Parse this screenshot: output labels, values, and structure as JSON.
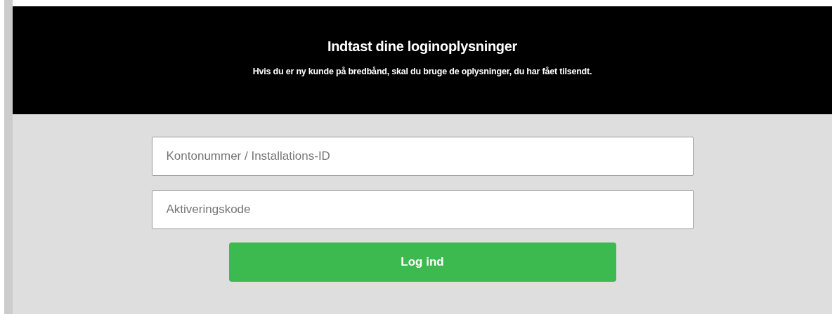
{
  "header": {
    "title": "Indtast dine loginoplysninger",
    "subtitle": "Hvis du er ny kunde på bredbånd, skal du bruge de oplysninger, du har fået tilsendt."
  },
  "fields": [
    {
      "placeholder": "Kontonummer / Installations-ID"
    },
    {
      "placeholder": "Aktiveringskode"
    }
  ],
  "button": {
    "label": "Log ind"
  }
}
